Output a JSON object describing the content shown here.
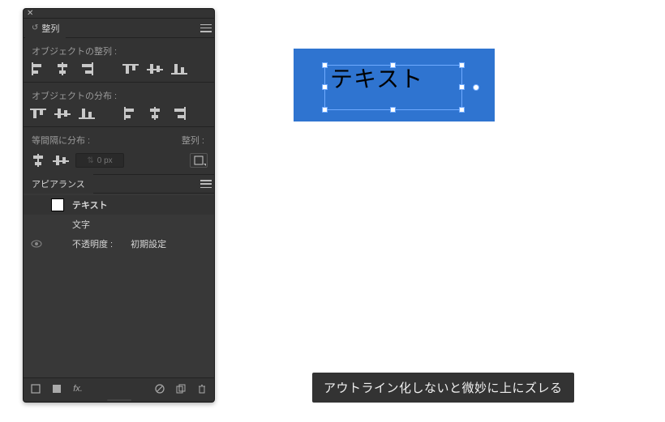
{
  "panel": {
    "tab_label": "整列",
    "section_align": "オブジェクトの整列 :",
    "section_distribute": "オブジェクトの分布 :",
    "section_spacing": "等間隔に分布 :",
    "align_to_label": "整列 :",
    "spacing_value": "0 px",
    "appearance_tab": "アピアランス",
    "appearance": {
      "row1_name": "テキスト",
      "row2_name": "文字",
      "row3_label": "不透明度 :",
      "row3_value": "初期設定"
    },
    "fx_label": "fx."
  },
  "canvas": {
    "text": "テキスト"
  },
  "caption": "アウトライン化しないと微妙に上にズレる"
}
